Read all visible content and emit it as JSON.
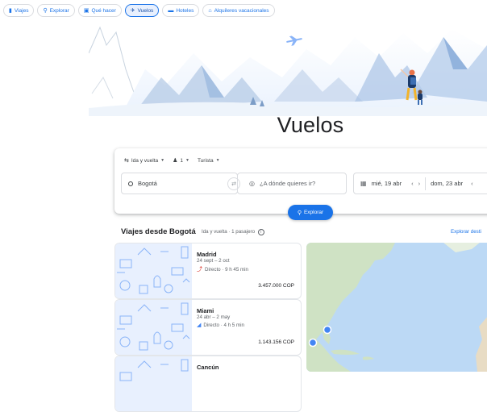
{
  "topnav": {
    "items": [
      {
        "label": "Viajes",
        "icon": "suitcase-icon"
      },
      {
        "label": "Explorar",
        "icon": "explore-icon"
      },
      {
        "label": "Qué hacer",
        "icon": "camera-icon"
      },
      {
        "label": "Vuelos",
        "icon": "plane-icon",
        "active": true
      },
      {
        "label": "Hoteles",
        "icon": "bed-icon"
      },
      {
        "label": "Alquileres vacacionales",
        "icon": "house-icon"
      }
    ]
  },
  "page": {
    "title": "Vuelos"
  },
  "search": {
    "trip_type": "Ida y vuelta",
    "passengers": "1",
    "cabin": "Turista",
    "origin": "Bogotá",
    "destination_placeholder": "¿A dónde quieres ir?",
    "depart_date": "mié, 19 abr",
    "return_date": "dom, 23 abr",
    "explore_button": "Explorar"
  },
  "section": {
    "title": "Viajes desde Bogotá",
    "subtitle": "Ida y vuelta · 1 pasajero",
    "link": "Explorar desti"
  },
  "destinations": [
    {
      "city": "Madrid",
      "dates": "24 sept – 2 oct",
      "flight": "Directo · 9 h 45 min",
      "price": "3.457.000 COP"
    },
    {
      "city": "Miami",
      "dates": "24 abr – 2 may",
      "flight": "Directo · 4 h 5 min",
      "price": "1.143.156 COP"
    },
    {
      "city": "Cancún",
      "dates": "",
      "flight": "",
      "price": ""
    }
  ],
  "colors": {
    "accent": "#1a73e8",
    "active_bg": "#e8f0fe",
    "map_water": "#bcd9f5",
    "map_land": "#cfe2c4"
  }
}
